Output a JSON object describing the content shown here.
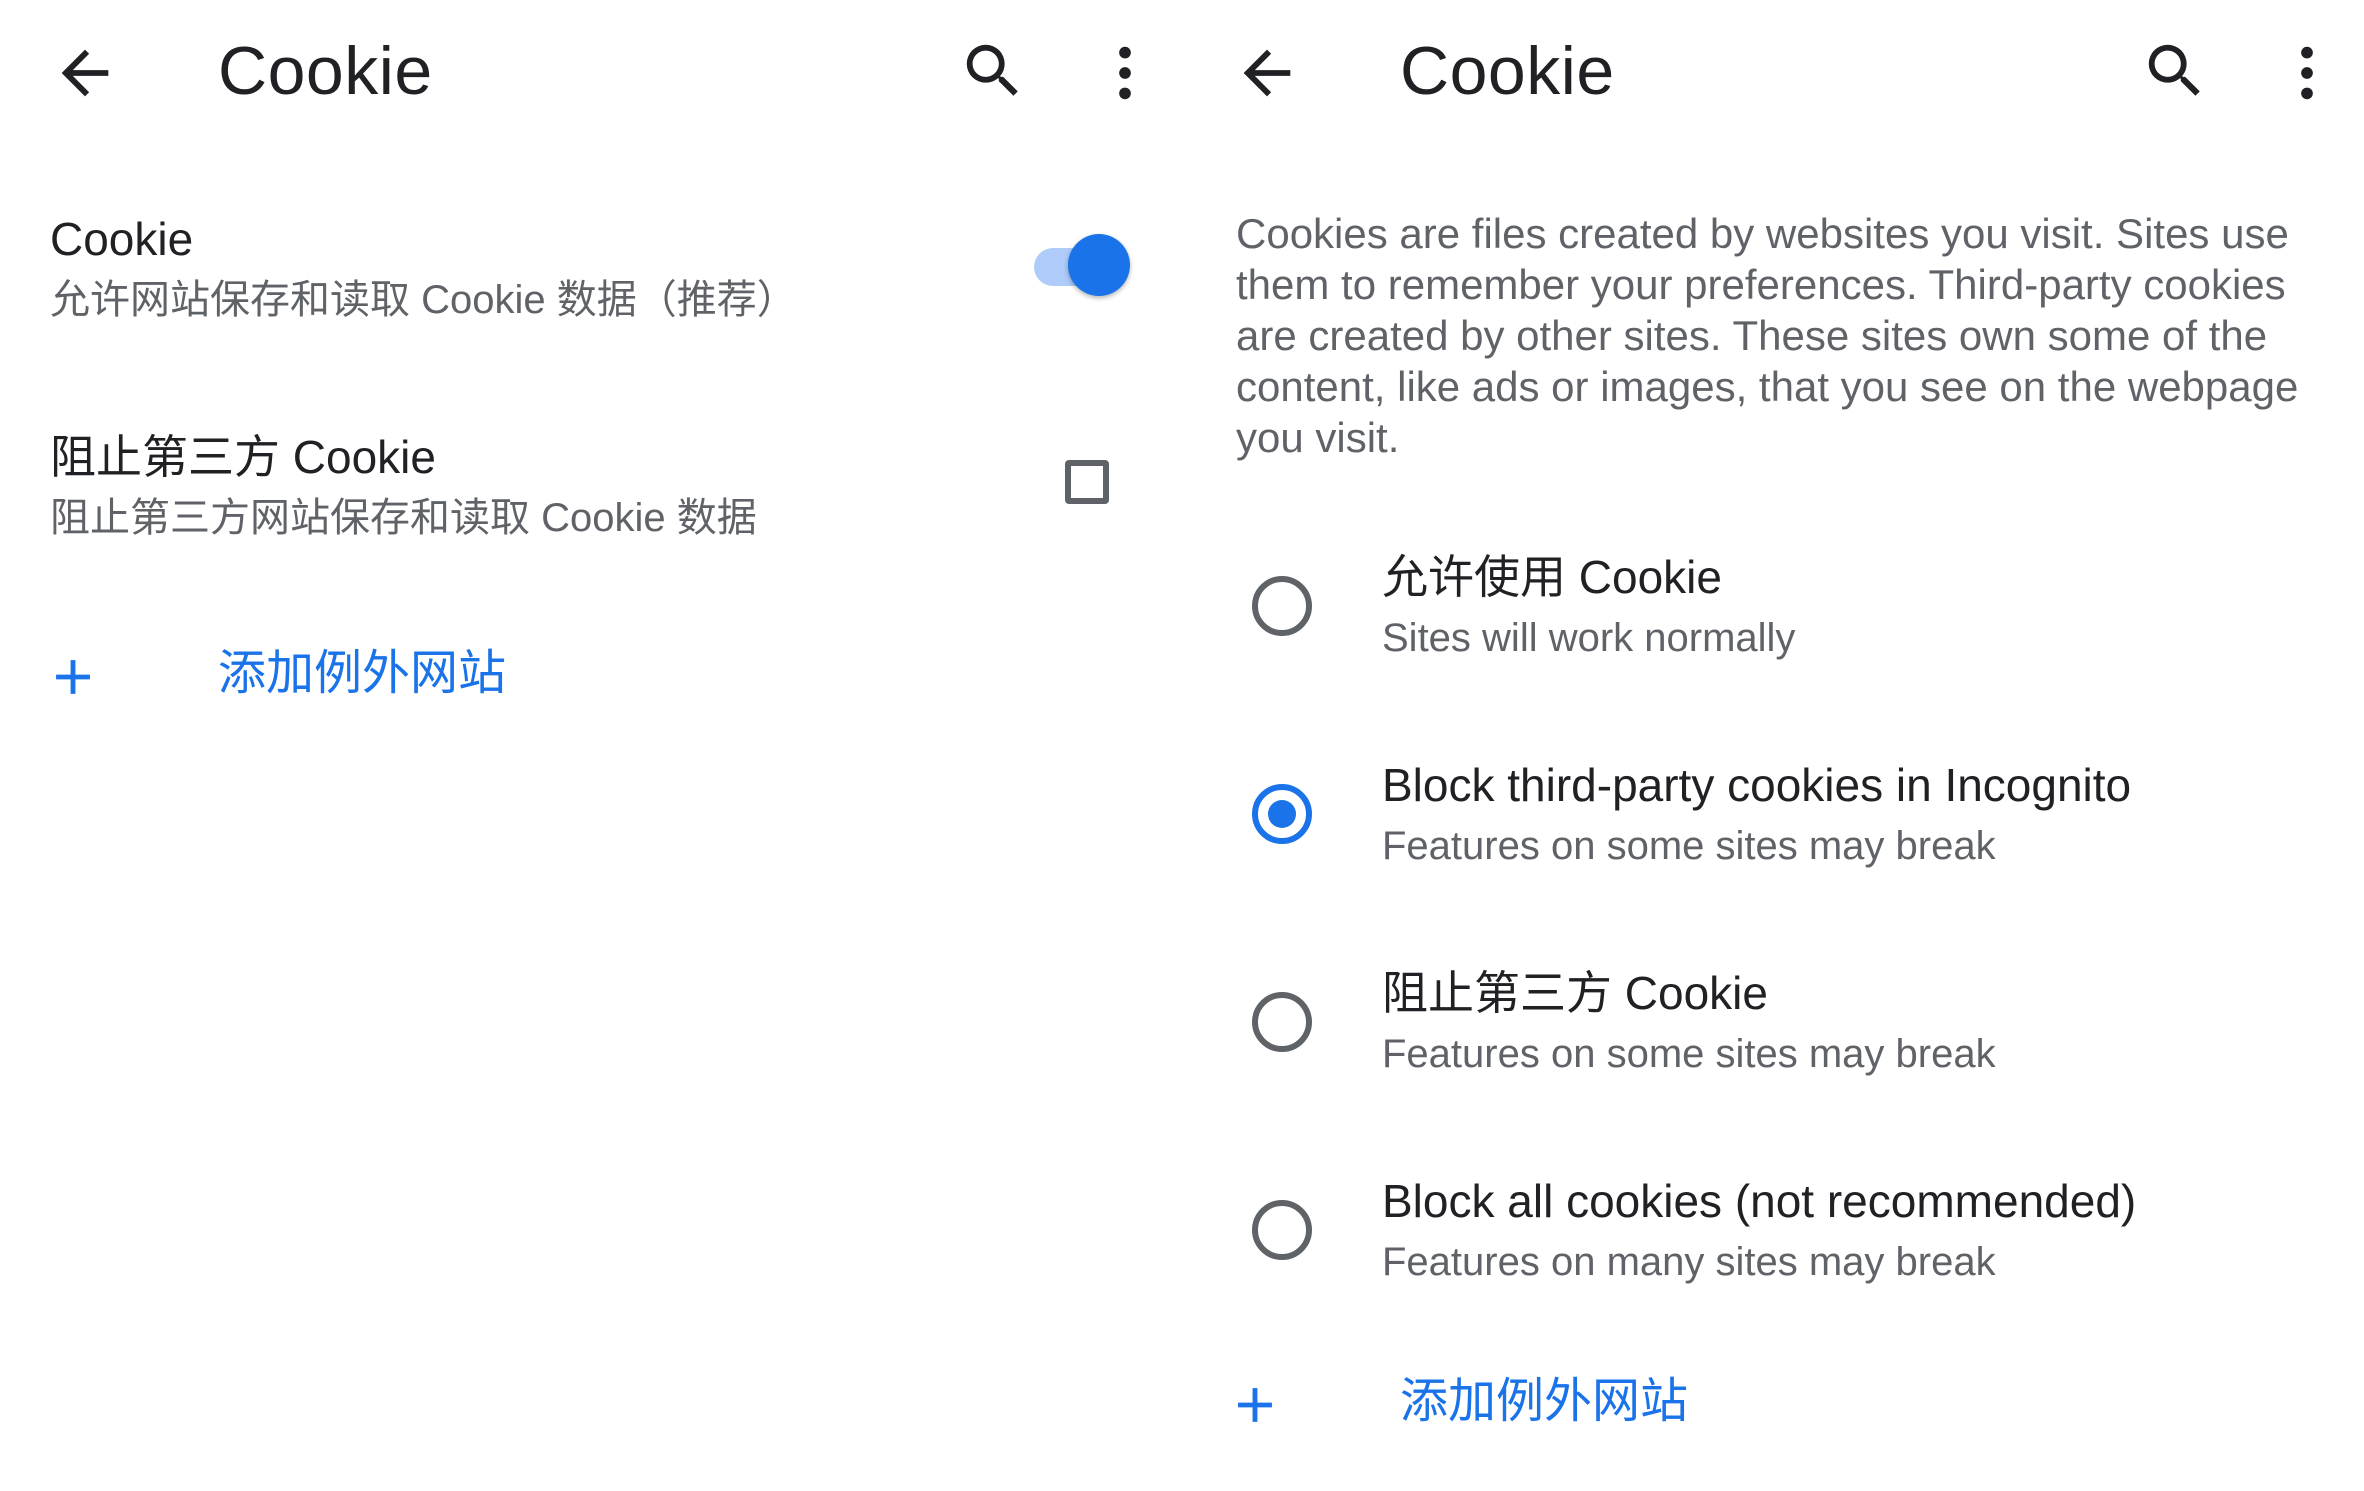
{
  "left_panel": {
    "toolbar": {
      "title": "Cookie",
      "back_icon": "arrow-back-icon",
      "search_icon": "search-icon",
      "more_icon": "more-vert-icon"
    },
    "cookie_setting": {
      "title": "Cookie",
      "subtitle": "允许网站保存和读取 Cookie 数据（推荐）",
      "toggle_on": true
    },
    "block_third_party": {
      "title": "阻止第三方 Cookie",
      "subtitle": "阻止第三方网站保存和读取 Cookie 数据",
      "checked": false
    },
    "add_exception": {
      "icon": "plus-icon",
      "label": "添加例外网站"
    }
  },
  "right_panel": {
    "toolbar": {
      "title": "Cookie",
      "back_icon": "arrow-back-icon",
      "search_icon": "search-icon",
      "more_icon": "more-vert-icon"
    },
    "description": "Cookies are files created by websites you visit. Sites use them to remember your preferences. Third-party cookies are created by other sites. These sites own some of the content, like ads or images, that you see on the webpage you visit.",
    "options": [
      {
        "title": "允许使用 Cookie",
        "subtitle": "Sites will work normally",
        "selected": false
      },
      {
        "title": "Block third-party cookies in Incognito",
        "subtitle": "Features on some sites may break",
        "selected": true
      },
      {
        "title": "阻止第三方 Cookie",
        "subtitle": "Features on some sites may break",
        "selected": false
      },
      {
        "title": "Block all cookies (not recommended)",
        "subtitle": "Features on many sites may break",
        "selected": false
      }
    ],
    "add_exception": {
      "icon": "plus-icon",
      "label": "添加例外网站"
    }
  },
  "colors": {
    "accent": "#1a73e8",
    "toggle_track": "#aecbfa",
    "secondary_text": "#5f6368",
    "primary_text": "#202124"
  }
}
